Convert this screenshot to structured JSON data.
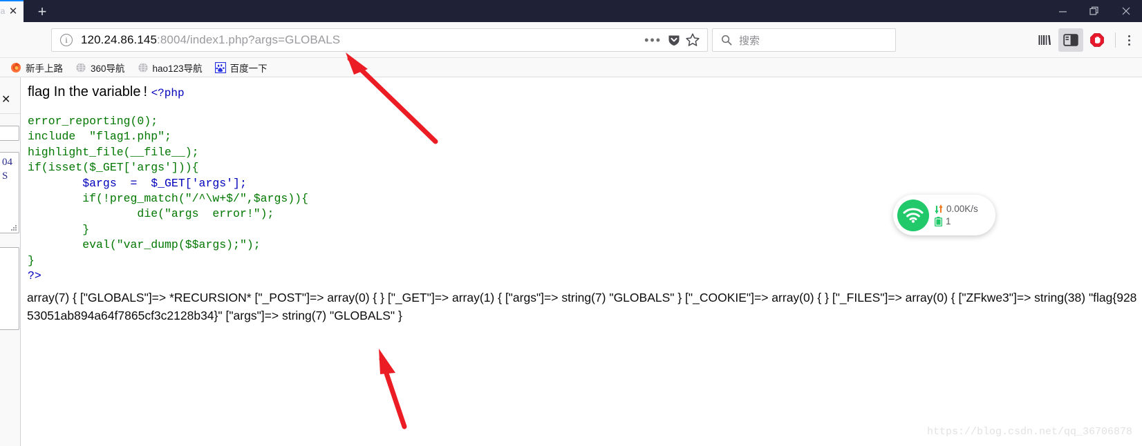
{
  "window": {
    "tab_title_fragment": "?a",
    "close_tab_glyph": "✕",
    "new_tab_glyph": "+",
    "minimize_label": "minimize",
    "restore_label": "restore",
    "close_label": "close"
  },
  "navbar": {
    "url_host": "120.24.86.145",
    "url_path": ":8004/index1.php?args=GLOBALS",
    "info_glyph": "i",
    "dots_glyph": "•••",
    "search_placeholder": "搜索",
    "library_label": "Library",
    "sidebar_label": "Sidebar",
    "adblock_label": "AdBlock",
    "menu_label": "Open menu"
  },
  "bookmarks": [
    {
      "label": "新手上路",
      "icon": "firefox-icon"
    },
    {
      "label": "360导航",
      "icon": "globe-icon"
    },
    {
      "label": "hao123导航",
      "icon": "globe-icon"
    },
    {
      "label": "百度一下",
      "icon": "baidu-icon"
    }
  ],
  "sidepanel": {
    "close_glyph": "✕",
    "text_line1": "04",
    "text_line2": "S"
  },
  "page": {
    "headline": "flag In the variable !",
    "php_open_tag": "<?php",
    "code_lines": [
      "error_reporting(0);",
      "include  \"flag1.php\";",
      "highlight_file(__file__);",
      "if(isset($_GET['args'])){",
      "        $args  =  $_GET['args'];",
      "        if(!preg_match(\"/^\\w+$/\",$args)){",
      "                die(\"args  error!\");",
      "        }",
      "        eval(\"var_dump($$args);\");",
      "}",
      "?>"
    ],
    "dump_output": "array(7) { [\"GLOBALS\"]=> *RECURSION* [\"_POST\"]=> array(0) { } [\"_GET\"]=> array(1) { [\"args\"]=> string(7) \"GLOBALS\" } [\"_COOKIE\"]=> array(0) { } [\"_FILES\"]=> array(0) { [\"ZFkwe3\"]=> string(38) \"flag{92853051ab894a64f7865cf3c2128b34}\" [\"args\"]=> string(7) \"GLOBALS\" }",
    "flag_value": "flag{92853051ab894a64f7865cf3c2128b34}"
  },
  "net_widget": {
    "speed": "0.00K/s",
    "connections": "1",
    "wifi_icon": "wifi-icon",
    "transfer_icon": "up-down-arrows-icon",
    "battery_icon": "battery-icon"
  },
  "watermark": {
    "text": "https://blog.csdn.net/qq_36706878"
  },
  "annotations": {
    "arrow1_label": "arrow-pointing-to-url",
    "arrow2_label": "arrow-pointing-to-flag"
  },
  "colors": {
    "titlebar": "#1f2136",
    "chrome": "#f9f9fa",
    "accent_blue": "#0a84ff",
    "code_keyword": "#007700",
    "code_string": "#dd0000",
    "code_variable": "#0000bb",
    "arrow_red": "#ec1c24",
    "wifi_green": "#22c96a"
  }
}
